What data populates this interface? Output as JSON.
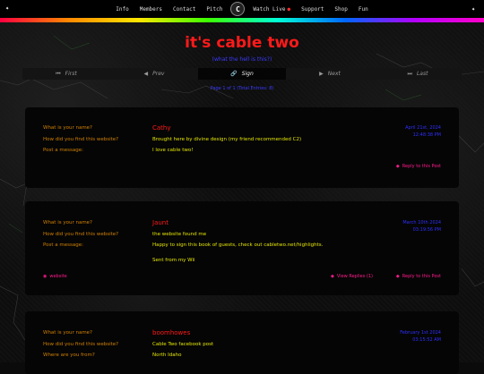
{
  "nav": {
    "items_left": [
      "Info",
      "Members",
      "Contact",
      "Pitch"
    ],
    "logo": "C",
    "items_right": [
      "Watch Live",
      "Support",
      "Shop",
      "Fun"
    ]
  },
  "page": {
    "title": "it's cable two",
    "subtitle": "(what the hell is this?)",
    "pageinfo": "Page 1 of 1 (Total Entries: 8)"
  },
  "pager": {
    "first": "First",
    "prev": "Prev",
    "sign": "Sign",
    "next": "Next",
    "last": "Last"
  },
  "labels": {
    "name": "What is your name?",
    "found": "How did you find this website?",
    "message": "Post a message:",
    "where": "Where are you from?"
  },
  "entries": [
    {
      "name": "Cathy",
      "found": "Brought here by divine design (my friend recommended C2)",
      "message": "I love cable two!",
      "date": "April 21st, 2024",
      "time": "12:48:38 PM",
      "reply": "Reply to this Post"
    },
    {
      "name": "Jaunt",
      "found": "the website found me",
      "message": "Happy to sign this book of guests, check out cabletwo.net/highlights.",
      "message2": "Sent from my Wii",
      "date": "March 10th 2024",
      "time": "03:19:56 PM",
      "website": "website",
      "view_replies": "View Replies (1)",
      "reply": "Reply to this Post"
    },
    {
      "name": "boomhowes",
      "found": "Cable Two facebook post",
      "where": "North Idaho",
      "date": "February 1st 2024",
      "time": "03:15:52 AM"
    }
  ]
}
